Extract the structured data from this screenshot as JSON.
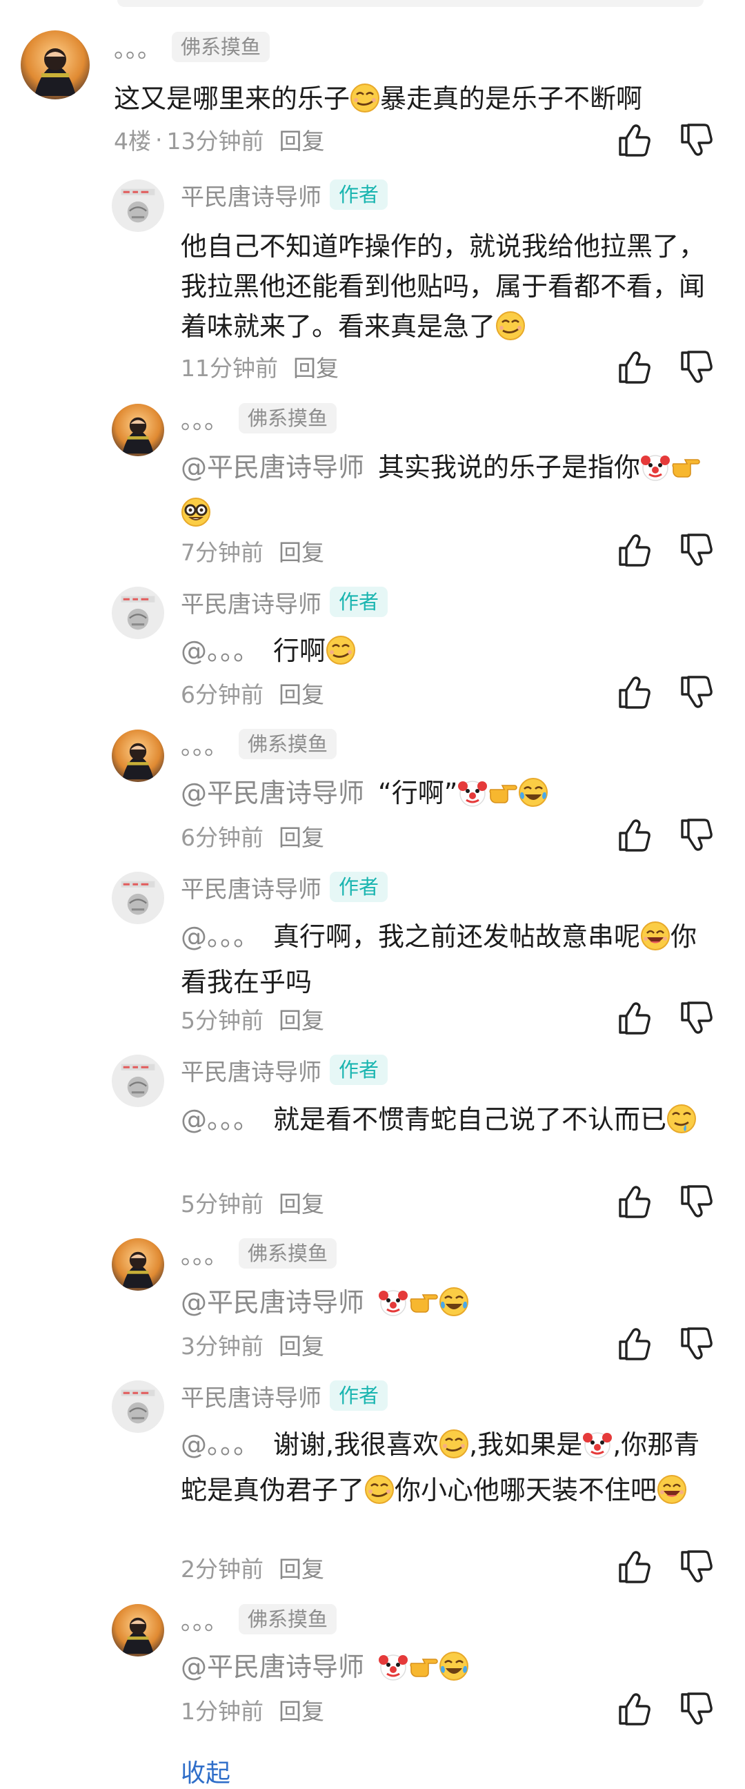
{
  "comments": [
    {
      "id": "c0",
      "user": "。。。",
      "badge": "佛系摸鱼",
      "text_parts": [
        {
          "t": "这又是哪里来的乐子"
        },
        {
          "e": "smirk-face"
        },
        {
          "t": "暴走真的是乐子不断啊"
        }
      ],
      "floor": "4楼",
      "time": "13分钟前",
      "reply": "回复"
    },
    {
      "id": "c1",
      "user": "平民唐诗导师",
      "badge": "作者",
      "text_parts": [
        {
          "t": "他自己不知道咋操作的，就说我给他拉黑了，我拉黑他还能看到他贴吗，属于看都不看，闻着味就来了。看来真是急了"
        },
        {
          "e": "smirk-face"
        }
      ],
      "time": "11分钟前",
      "reply": "回复"
    },
    {
      "id": "c2",
      "user": "。。。",
      "badge": "佛系摸鱼",
      "mention": "@平民唐诗导师",
      "text_parts": [
        {
          "t": "其实我说的乐子是指你"
        },
        {
          "e": "clown-face"
        },
        {
          "e": "pointing-right"
        },
        {
          "e": "nerd-face"
        }
      ],
      "time": "7分钟前",
      "reply": "回复"
    },
    {
      "id": "c3",
      "user": "平民唐诗导师",
      "badge": "作者",
      "mention": "@。。。",
      "text_parts": [
        {
          "t": "行啊"
        },
        {
          "e": "smirk-face"
        }
      ],
      "time": "6分钟前",
      "reply": "回复"
    },
    {
      "id": "c4",
      "user": "。。。",
      "badge": "佛系摸鱼",
      "mention": "@平民唐诗导师",
      "text_parts": [
        {
          "t": "“行啊”"
        },
        {
          "e": "clown-face"
        },
        {
          "e": "pointing-right"
        },
        {
          "e": "tears-of-joy-face"
        }
      ],
      "time": "6分钟前",
      "reply": "回复"
    },
    {
      "id": "c5",
      "user": "平民唐诗导师",
      "badge": "作者",
      "mention": "@。。。",
      "text_parts": [
        {
          "t": "真行啊，我之前还发帖故意串呢"
        },
        {
          "e": "grinning-face"
        },
        {
          "t": "你看我在乎吗"
        }
      ],
      "time": "5分钟前",
      "reply": "回复"
    },
    {
      "id": "c6",
      "user": "平民唐诗导师",
      "badge": "作者",
      "mention": "@。。。",
      "text_parts": [
        {
          "t": "就是看不惯青蛇自己说了不认而已"
        },
        {
          "e": "drooling-face"
        }
      ],
      "time": "5分钟前",
      "reply": "回复"
    },
    {
      "id": "c7",
      "user": "。。。",
      "badge": "佛系摸鱼",
      "mention": "@平民唐诗导师",
      "text_parts": [
        {
          "e": "clown-face"
        },
        {
          "e": "pointing-right"
        },
        {
          "e": "tears-of-joy-face"
        }
      ],
      "time": "3分钟前",
      "reply": "回复"
    },
    {
      "id": "c8",
      "user": "平民唐诗导师",
      "badge": "作者",
      "mention": "@。。。",
      "text_parts": [
        {
          "t": "谢谢,我很喜欢"
        },
        {
          "e": "smirk-face"
        },
        {
          "t": ",我如果是"
        },
        {
          "e": "clown-face"
        },
        {
          "t": ",你那青蛇是真伪君子了"
        },
        {
          "e": "smirk-face"
        },
        {
          "t": "你小心他哪天装不住吧"
        },
        {
          "e": "grinning-face"
        }
      ],
      "time": "2分钟前",
      "reply": "回复"
    },
    {
      "id": "c9",
      "user": "。。。",
      "badge": "佛系摸鱼",
      "mention": "@平民唐诗导师",
      "text_parts": [
        {
          "e": "clown-face"
        },
        {
          "e": "pointing-right"
        },
        {
          "e": "tears-of-joy-face"
        }
      ],
      "time": "1分钟前",
      "reply": "回复"
    }
  ],
  "collapse_label": "收起",
  "icons": {
    "like": "thumbs-up-icon",
    "dislike": "thumbs-down-icon"
  }
}
